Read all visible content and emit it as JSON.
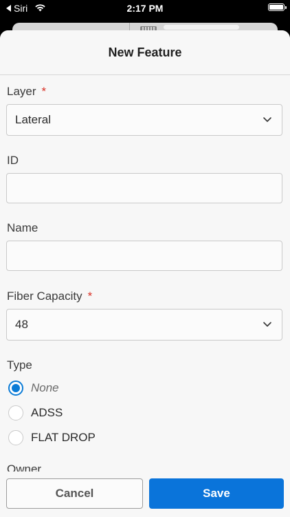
{
  "status_bar": {
    "back_label": "Siri",
    "time": "2:17 PM",
    "battery_level": 1.0
  },
  "sheet": {
    "title": "New Feature"
  },
  "form": {
    "layer": {
      "label": "Layer",
      "required_mark": "*",
      "value": "Lateral"
    },
    "id": {
      "label": "ID",
      "value": ""
    },
    "name": {
      "label": "Name",
      "value": ""
    },
    "fiber_capacity": {
      "label": "Fiber Capacity",
      "required_mark": "*",
      "value": "48"
    },
    "type": {
      "label": "Type",
      "options": [
        {
          "label": "None",
          "selected": true
        },
        {
          "label": "ADSS",
          "selected": false
        },
        {
          "label": "FLAT DROP",
          "selected": false
        }
      ]
    },
    "owner": {
      "label": "Owner"
    }
  },
  "footer": {
    "cancel_label": "Cancel",
    "save_label": "Save"
  },
  "colors": {
    "accent": "#0a74da",
    "required": "#d93025"
  },
  "icons": {
    "wifi": "wifi-icon",
    "battery": "battery-icon",
    "chevron": "chevron-down-icon",
    "back": "back-arrow-icon"
  }
}
